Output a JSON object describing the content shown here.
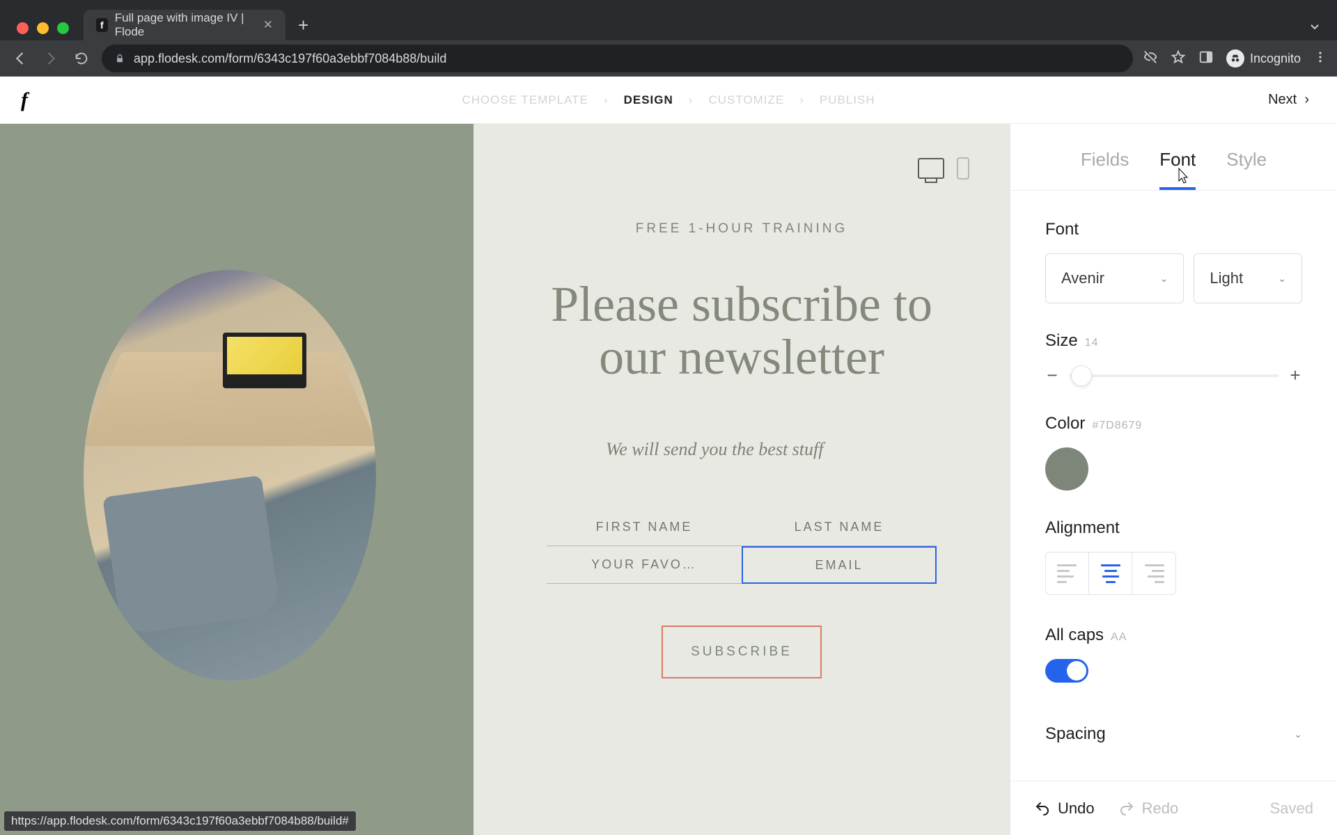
{
  "browser": {
    "tab_title": "Full page with image IV | Flode",
    "url": "app.flodesk.com/form/6343c197f60a3ebbf7084b88/build",
    "incognito_label": "Incognito",
    "status_url": "https://app.flodesk.com/form/6343c197f60a3ebbf7084b88/build#"
  },
  "header": {
    "logo": "f",
    "steps": [
      "CHOOSE TEMPLATE",
      "DESIGN",
      "CUSTOMIZE",
      "PUBLISH"
    ],
    "active_step_index": 1,
    "next": "Next"
  },
  "canvas": {
    "eyebrow": "FREE 1-HOUR TRAINING",
    "headline": "Please subscribe to our newsletter",
    "subtext": "We will send you the best stuff",
    "fields": {
      "first_name": "FIRST NAME",
      "last_name": "LAST NAME",
      "favorite": "YOUR FAVO…",
      "email": "EMAIL"
    },
    "button": "SUBSCRIBE"
  },
  "sidebar": {
    "tabs": [
      "Fields",
      "Font",
      "Style"
    ],
    "active_tab_index": 1,
    "font_label": "Font",
    "font_family": "Avenir",
    "font_weight": "Light",
    "size_label": "Size",
    "size_value": "14",
    "color_label": "Color",
    "color_value": "#7D8679",
    "alignment_label": "Alignment",
    "allcaps_label": "All caps",
    "allcaps_hint": "AA",
    "spacing_label": "Spacing",
    "undo": "Undo",
    "redo": "Redo",
    "saved": "Saved"
  }
}
